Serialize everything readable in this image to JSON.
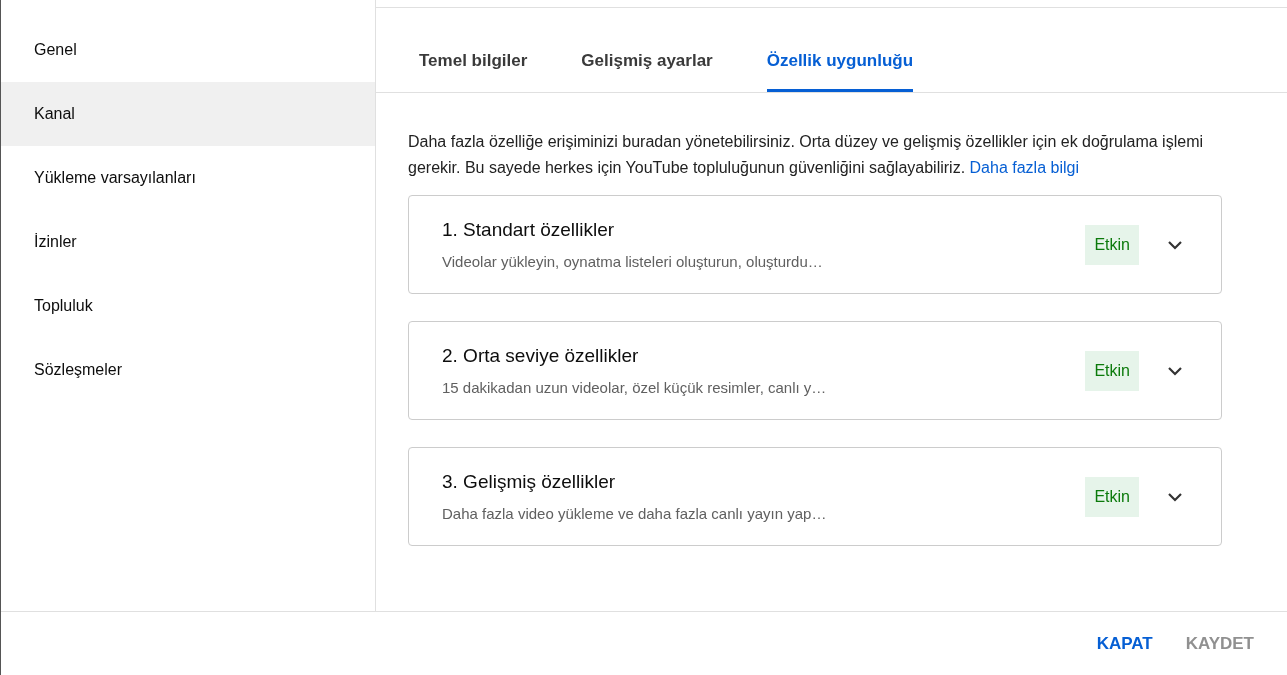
{
  "sidebar": {
    "items": [
      {
        "label": "Genel",
        "selected": false
      },
      {
        "label": "Kanal",
        "selected": true
      },
      {
        "label": "Yükleme varsayılanları",
        "selected": false
      },
      {
        "label": "İzinler",
        "selected": false
      },
      {
        "label": "Topluluk",
        "selected": false
      },
      {
        "label": "Sözleşmeler",
        "selected": false
      }
    ]
  },
  "tabs": [
    {
      "label": "Temel bilgiler",
      "selected": false
    },
    {
      "label": "Gelişmiş ayarlar",
      "selected": false
    },
    {
      "label": "Özellik uygunluğu",
      "selected": true
    }
  ],
  "description": {
    "text": "Daha fazla özelliğe erişiminizi buradan yönetebilirsiniz. Orta düzey ve gelişmiş özellikler için ek doğrulama işlemi gerekir. Bu sayede herkes için YouTube topluluğunun güvenliğini sağlayabiliriz.",
    "link": "Daha fazla bilgi"
  },
  "features": [
    {
      "title": "1. Standart özellikler",
      "subtitle": "Videolar yükleyin, oynatma listeleri oluşturun, oluşturdu…",
      "status": "Etkin",
      "expanded": false
    },
    {
      "title": "2. Orta seviye özellikler",
      "subtitle": "15 dakikadan uzun videolar, özel küçük resimler, canlı y…",
      "status": "Etkin",
      "expanded": false
    },
    {
      "title": "3. Gelişmiş özellikler",
      "subtitle": "Daha fazla video yükleme ve daha fazla canlı yayın yap…",
      "status": "Etkin",
      "expanded": false
    }
  ],
  "buttons": [
    {
      "label": "KAPAT",
      "disabled": false
    },
    {
      "label": "KAYDET",
      "disabled": true
    }
  ]
}
